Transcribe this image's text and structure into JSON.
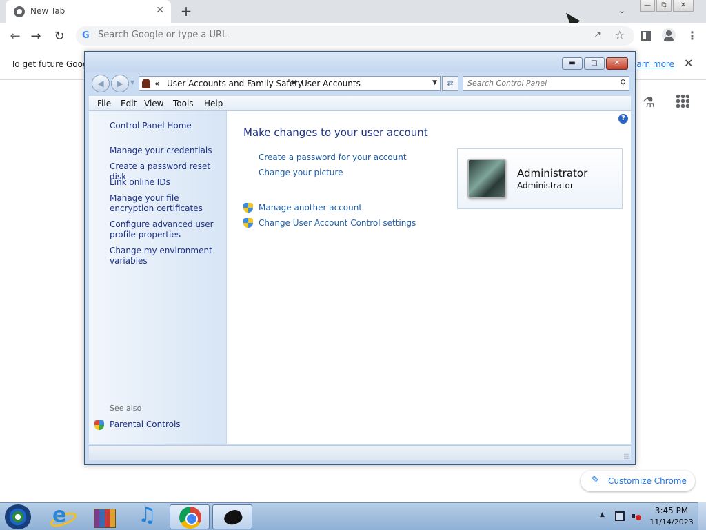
{
  "browser": {
    "tab_title": "New Tab",
    "tab_close": "✕",
    "new_tab": "+",
    "omnibox_placeholder": "Search Google or type a URL",
    "infobar_text": "To get future Goog",
    "learn_more": "earn more",
    "infobar_close": "✕",
    "customize_label": "Customize Chrome"
  },
  "control_panel": {
    "breadcrumb_root": "«",
    "breadcrumb": [
      "User Accounts and Family Safety",
      "User Accounts"
    ],
    "search_placeholder": "Search Control Panel",
    "menu": [
      "File",
      "Edit",
      "View",
      "Tools",
      "Help"
    ],
    "sidebar": {
      "home": "Control Panel Home",
      "links": [
        "Manage your credentials",
        "Create a password reset disk",
        "Link online IDs",
        "Manage your file encryption certificates",
        "Configure advanced user profile properties",
        "Change my environment variables"
      ],
      "see_also_label": "See also",
      "see_also_links": [
        "Parental Controls"
      ]
    },
    "main": {
      "heading": "Make changes to your user account",
      "links": [
        "Create a password for your account",
        "Change your picture"
      ],
      "admin_links": [
        "Manage another account",
        "Change User Account Control settings"
      ],
      "user_name": "Administrator",
      "user_role": "Administrator"
    }
  },
  "taskbar": {
    "items": [
      "start",
      "internet-explorer",
      "archive",
      "music",
      "chrome",
      "control-panel"
    ],
    "clock_time": "3:45 PM",
    "clock_date": "11/14/2023"
  }
}
